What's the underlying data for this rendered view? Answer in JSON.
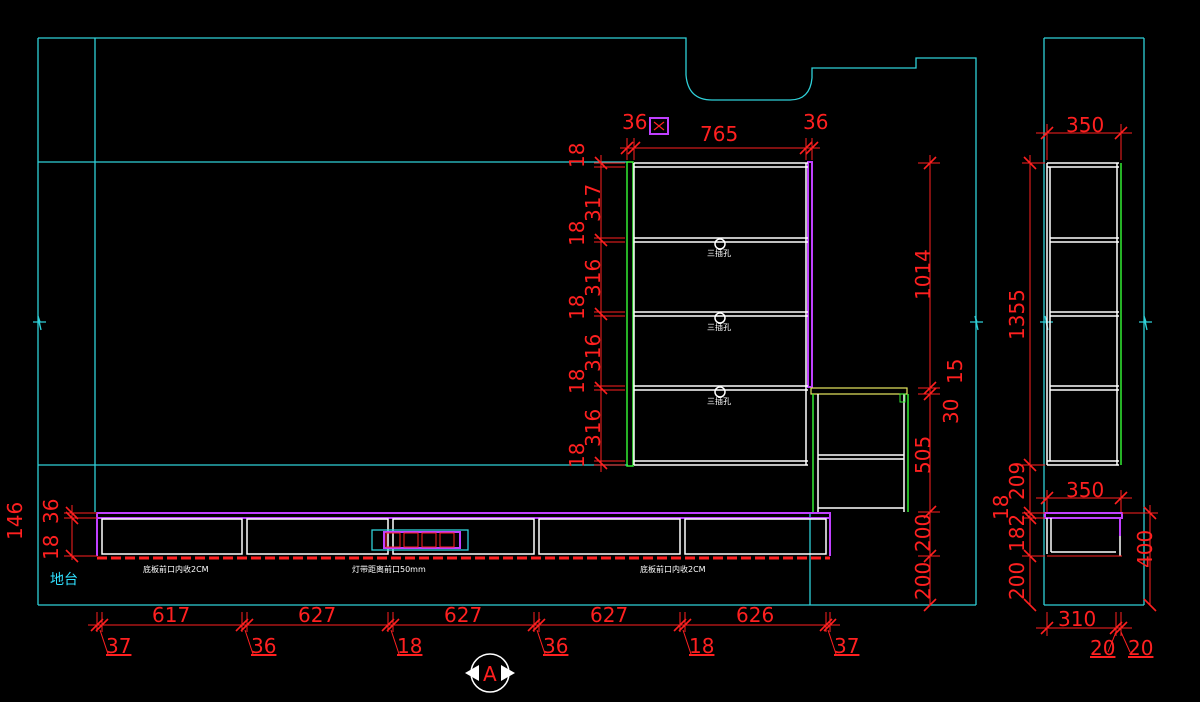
{
  "colors": {
    "background": "#000000",
    "outline": "#2fd0d8",
    "cabinet": "#ffffff",
    "dimension": "#ff2020",
    "accent_magenta": "#c040ff",
    "accent_green": "#33ee33",
    "floor_label": "#30e0ff"
  },
  "labels": {
    "floor": "地台",
    "socket_note": "三插孔",
    "base_note_left": "底板前口内收2CM",
    "base_note_right": "底板前口内收2CM",
    "led_note": "灯带距离前口50mm",
    "section_marker": "A"
  },
  "dimensions": {
    "wall_cabinet": {
      "top_left": "36",
      "top_width": "765",
      "top_right": "36",
      "left_stack": [
        "18",
        "317",
        "18",
        "316",
        "18",
        "316",
        "18",
        "316",
        "18"
      ],
      "right_height": "1014",
      "right_small_a": "30",
      "right_small_b": "15",
      "right_mid": "505",
      "right_low": "200",
      "right_floor": "200"
    },
    "tv_unit_left": [
      "146",
      "36",
      "18"
    ],
    "bottom_row": [
      "617",
      "627",
      "627",
      "627",
      "626"
    ],
    "bottom_sub": [
      "37",
      "36",
      "18",
      "36",
      "18",
      "37"
    ],
    "side_view": {
      "top_width": "350",
      "height": "1355",
      "base_width": "350",
      "stack": [
        "209",
        "18",
        "182",
        "200"
      ],
      "base_height": "400",
      "bottom_width": "310",
      "bottom_left": "20",
      "bottom_right": "20"
    }
  }
}
